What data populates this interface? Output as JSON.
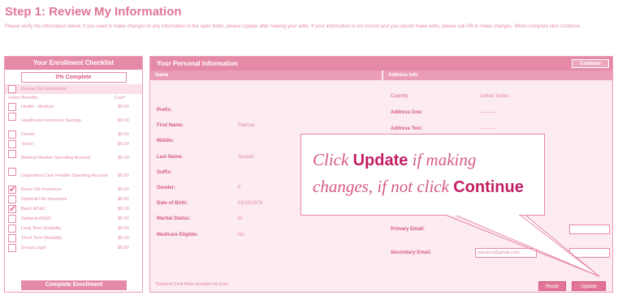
{
  "page": {
    "title": "Step 1: Review My Information",
    "intro": "Please verify the information below. If you need to make changes to any information in the open fields, please Update after making your edits. If your information is not correct and you cannot make edits, please call HR to make changes. When complete click Continue."
  },
  "checklist": {
    "header": "Your Enrollment Checklist",
    "progress": "0% Complete",
    "first_item": "Review My Information",
    "sub_header": {
      "label": "Select Benefits",
      "cost": "Cost*"
    },
    "items": [
      {
        "label": "Health - Medical",
        "cost": "$0.00",
        "checked": false
      },
      {
        "label": "Healthcare Incentives Savings",
        "cost": "$0.00",
        "checked": false
      },
      {
        "label": "Dental",
        "cost": "$0.00",
        "checked": false
      },
      {
        "label": "Vision",
        "cost": "$0.00",
        "checked": false
      },
      {
        "label": "Medical Flexible Spending Account",
        "cost": "$0.00",
        "checked": false
      },
      {
        "label": "Dependent Care Flexible Spending Account",
        "cost": "$0.00",
        "checked": false
      },
      {
        "label": "Basic Life Insurance",
        "cost": "$0.00",
        "checked": true
      },
      {
        "label": "Optional Life Insurance",
        "cost": "$0.00",
        "checked": false
      },
      {
        "label": "Basic AD&D",
        "cost": "$0.00",
        "checked": true
      },
      {
        "label": "Optional AD&D",
        "cost": "$0.00",
        "checked": false
      },
      {
        "label": "Long Term Disability",
        "cost": "$0.00",
        "checked": false
      },
      {
        "label": "Short Term Disability",
        "cost": "$0.00",
        "checked": false
      },
      {
        "label": "Group Legal",
        "cost": "$0.00",
        "checked": false
      }
    ],
    "footer_button": "Complete Enrollment"
  },
  "panel": {
    "header": "Your Personal Information",
    "continue_button": "Continue",
    "col_name": "Name",
    "col_address": "Address Info",
    "fields": {
      "prefix": {
        "label": "Prefix:",
        "value": ""
      },
      "first_name": {
        "label": "First Name:",
        "value": "Patricia"
      },
      "middle": {
        "label": "Middle:",
        "value": ""
      },
      "last_name": {
        "label": "Last Name:",
        "value": "Alvarez"
      },
      "suffix": {
        "label": "Suffix:",
        "value": ""
      },
      "gender": {
        "label": "Gender:",
        "value": "F"
      },
      "dob": {
        "label": "Date of Birth:",
        "value": "03/15/1978"
      },
      "marital": {
        "label": "Marital Status:",
        "value": "M"
      },
      "medicare": {
        "label": "Medicare Eligible:",
        "value": "No"
      }
    },
    "address": {
      "country": {
        "label": "Country:",
        "value": "United States"
      },
      "address_one": {
        "label": "Address One:",
        "value": "----------"
      },
      "address_two": {
        "label": "Address Two:",
        "value": "----------"
      },
      "primary_email": {
        "label": "Primary Email:",
        "value": ""
      },
      "secondary_email": {
        "label": "Secondary Email:",
        "value": "palvarez@gmail.com"
      }
    },
    "required_note": "*Required Field When Available for Entry",
    "reset_button": "Reset",
    "update_button": "Update"
  },
  "callout": {
    "line1_pre": "Click ",
    "line1_bold": "Update",
    "line1_post": " if making",
    "line2_pre": "changes, if not click ",
    "line2_bold": "Continue"
  }
}
